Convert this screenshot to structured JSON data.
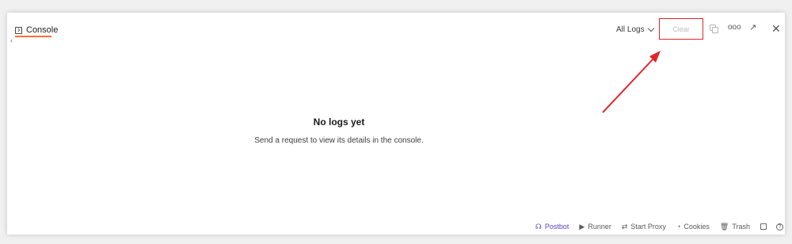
{
  "window": {
    "tab_label": "Console"
  },
  "toolbar": {
    "filter_label": "All Logs",
    "clear_label": "Clear",
    "highlight_color": "#e0262a"
  },
  "empty_state": {
    "title": "No logs yet",
    "description": "Send a request to view its details in the console."
  },
  "statusbar": {
    "items": [
      {
        "label": "Postbot",
        "icon": "postbot-icon"
      },
      {
        "label": "Runner",
        "icon": "runner-icon"
      },
      {
        "label": "Start Proxy",
        "icon": "proxy-icon"
      },
      {
        "label": "Cookies",
        "icon": "cookie-icon"
      },
      {
        "label": "Trash",
        "icon": "trash-icon"
      }
    ]
  },
  "colors": {
    "accent_orange": "#ff6c37",
    "postbot_purple": "#5b3fc4",
    "annotation_red": "#e0262a"
  }
}
